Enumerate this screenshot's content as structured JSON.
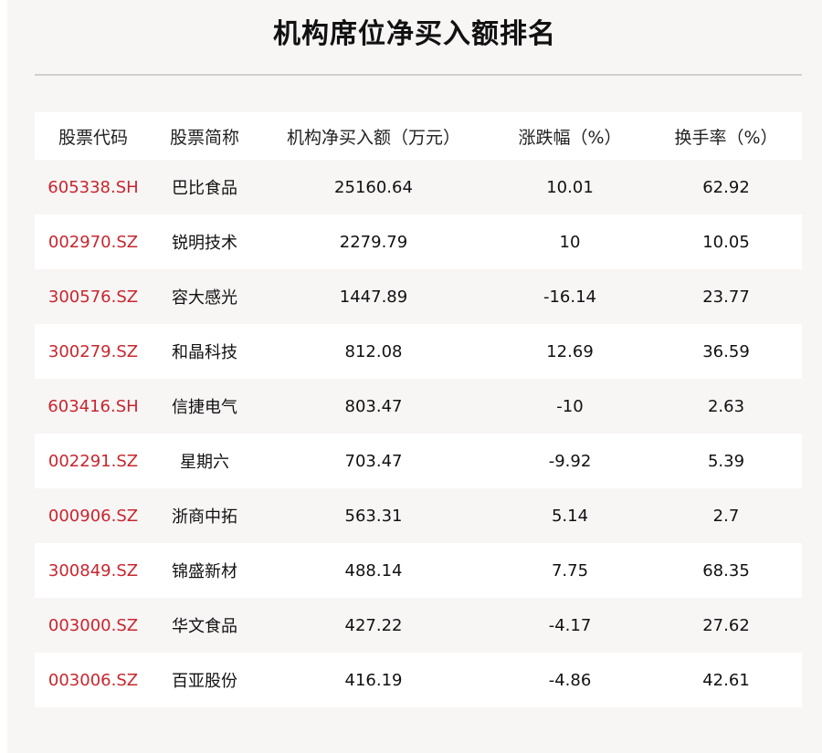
{
  "title": "机构席位净买入额排名",
  "headers": [
    "股票代码",
    "股票简称",
    "机构净买入额（万元）",
    "涨跌幅（%）",
    "换手率（%）"
  ],
  "rows": [
    {
      "code": "605338.SH",
      "name": "巴比食品",
      "net_buy": "25160.64",
      "change": "10.01",
      "turnover": "62.92"
    },
    {
      "code": "002970.SZ",
      "name": "锐明技术",
      "net_buy": "2279.79",
      "change": "10",
      "turnover": "10.05"
    },
    {
      "code": "300576.SZ",
      "name": "容大感光",
      "net_buy": "1447.89",
      "change": "-16.14",
      "turnover": "23.77"
    },
    {
      "code": "300279.SZ",
      "name": "和晶科技",
      "net_buy": "812.08",
      "change": "12.69",
      "turnover": "36.59"
    },
    {
      "code": "603416.SH",
      "name": "信捷电气",
      "net_buy": "803.47",
      "change": "-10",
      "turnover": "2.63"
    },
    {
      "code": "002291.SZ",
      "name": "星期六",
      "net_buy": "703.47",
      "change": "-9.92",
      "turnover": "5.39"
    },
    {
      "code": "000906.SZ",
      "name": "浙商中拓",
      "net_buy": "563.31",
      "change": "5.14",
      "turnover": "2.7"
    },
    {
      "code": "300849.SZ",
      "name": "锦盛新材",
      "net_buy": "488.14",
      "change": "7.75",
      "turnover": "68.35"
    },
    {
      "code": "003000.SZ",
      "name": "华文食品",
      "net_buy": "427.22",
      "change": "-4.17",
      "turnover": "27.62"
    },
    {
      "code": "003006.SZ",
      "name": "百亚股份",
      "net_buy": "416.19",
      "change": "-4.86",
      "turnover": "42.61"
    }
  ],
  "colors": {
    "code_text": "#c8262e",
    "panel_bg": "#f8f5f5",
    "row_alt_bg": "#ffffff"
  }
}
